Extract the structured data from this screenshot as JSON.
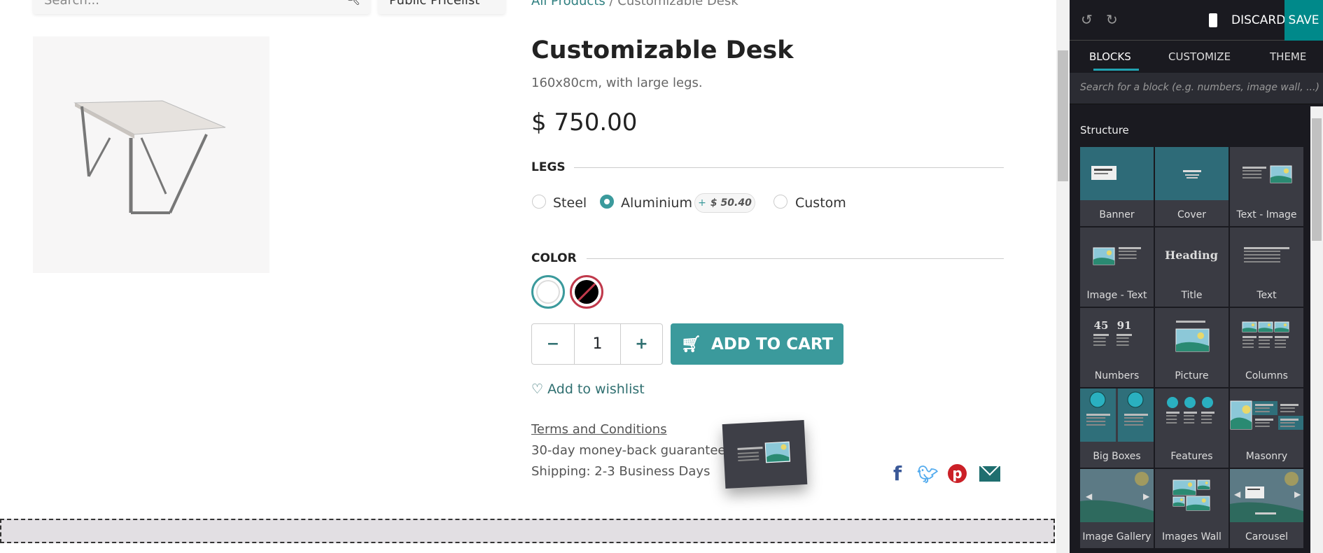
{
  "header": {
    "search_placeholder": "Search...",
    "pricelist": "Public Pricelist",
    "breadcrumb": [
      "All Products",
      "Customizable Desk"
    ]
  },
  "product": {
    "name": "Customizable Desk",
    "description": "160x80cm, with large legs.",
    "price": "$ 750.00",
    "legs": {
      "label": "LEGS",
      "options": [
        {
          "label": "Steel",
          "selected": false
        },
        {
          "label": "Aluminium",
          "selected": true,
          "extra": "$ 50.40"
        },
        {
          "label": "Custom",
          "selected": false
        }
      ]
    },
    "color": {
      "label": "COLOR",
      "swatches": [
        {
          "color": "#ffffff",
          "selected": true
        },
        {
          "color": "#000000",
          "unavailable": true
        }
      ]
    },
    "quantity": "1",
    "add_to_cart": "ADD TO CART",
    "wishlist": "Add to wishlist",
    "terms": "Terms and Conditions",
    "guarantee": "30-day money-back guarantee",
    "shipping": "Shipping: 2-3 Business Days"
  },
  "social": [
    "facebook-icon",
    "twitter-icon",
    "pinterest-icon",
    "email-icon"
  ],
  "editor": {
    "discard": "DISCARD",
    "save": "SAVE",
    "tabs": [
      "BLOCKS",
      "CUSTOMIZE",
      "THEME"
    ],
    "active_tab": "BLOCKS",
    "search_placeholder": "Search for a block (e.g. numbers, image wall, ...)",
    "section": "Structure",
    "blocks": [
      {
        "label": "Banner",
        "icon": "banner"
      },
      {
        "label": "Cover",
        "icon": "cover"
      },
      {
        "label": "Text - Image",
        "icon": "text-image"
      },
      {
        "label": "Image - Text",
        "icon": "image-text"
      },
      {
        "label": "Title",
        "icon": "title",
        "text": "Heading"
      },
      {
        "label": "Text",
        "icon": "text"
      },
      {
        "label": "Numbers",
        "icon": "numbers",
        "text": [
          "45",
          "91"
        ]
      },
      {
        "label": "Picture",
        "icon": "picture"
      },
      {
        "label": "Columns",
        "icon": "columns"
      },
      {
        "label": "Big Boxes",
        "icon": "big-boxes"
      },
      {
        "label": "Features",
        "icon": "features"
      },
      {
        "label": "Masonry",
        "icon": "masonry"
      },
      {
        "label": "Image Gallery",
        "icon": "image-gallery"
      },
      {
        "label": "Images Wall",
        "icon": "images-wall"
      },
      {
        "label": "Carousel",
        "icon": "carousel"
      }
    ]
  },
  "colors": {
    "accent": "#3b9a9c",
    "save": "#00898a",
    "panel": "#1a1a20"
  }
}
